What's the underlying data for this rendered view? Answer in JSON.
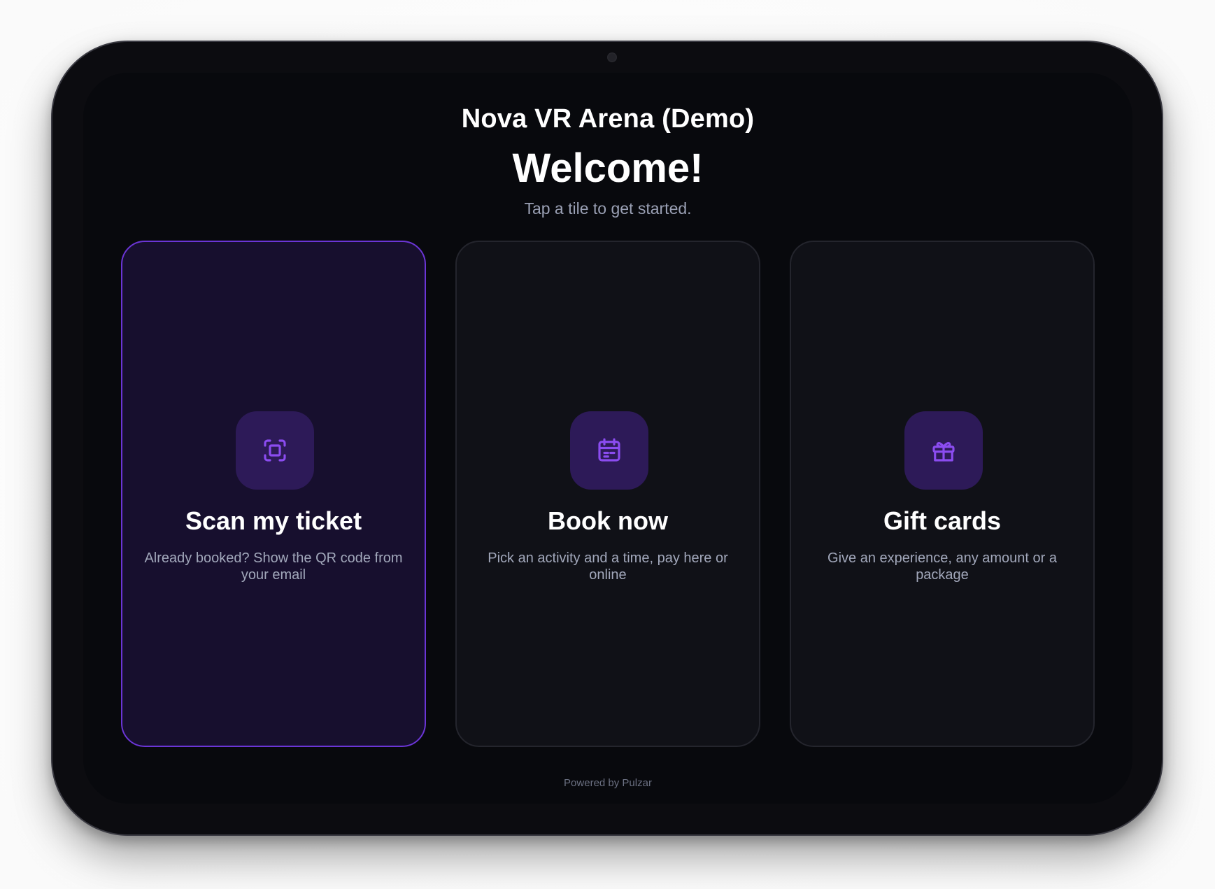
{
  "header": {
    "venue_title": "Nova VR Arena (Demo)",
    "welcome": "Welcome!",
    "subtitle": "Tap a tile to get started."
  },
  "tiles": [
    {
      "title": "Scan my ticket",
      "description": "Already booked? Show the QR code from your email",
      "icon": "scan-icon",
      "selected": true
    },
    {
      "title": "Book now",
      "description": "Pick an activity and a time, pay here or online",
      "icon": "calendar-icon",
      "selected": false
    },
    {
      "title": "Gift cards",
      "description": "Give an experience, any amount or a package",
      "icon": "gift-icon",
      "selected": false
    }
  ],
  "footer": {
    "powered_by": "Powered by Pulzar"
  },
  "colors": {
    "accent": "#6b35d6",
    "icon_purple": "#8b4cf0",
    "icon_bg": "#2d1a58",
    "screen_bg": "#08090d",
    "tile_bg": "#101117",
    "tile_active_bg": "#170f2e",
    "muted_text": "#9aa0b4"
  }
}
